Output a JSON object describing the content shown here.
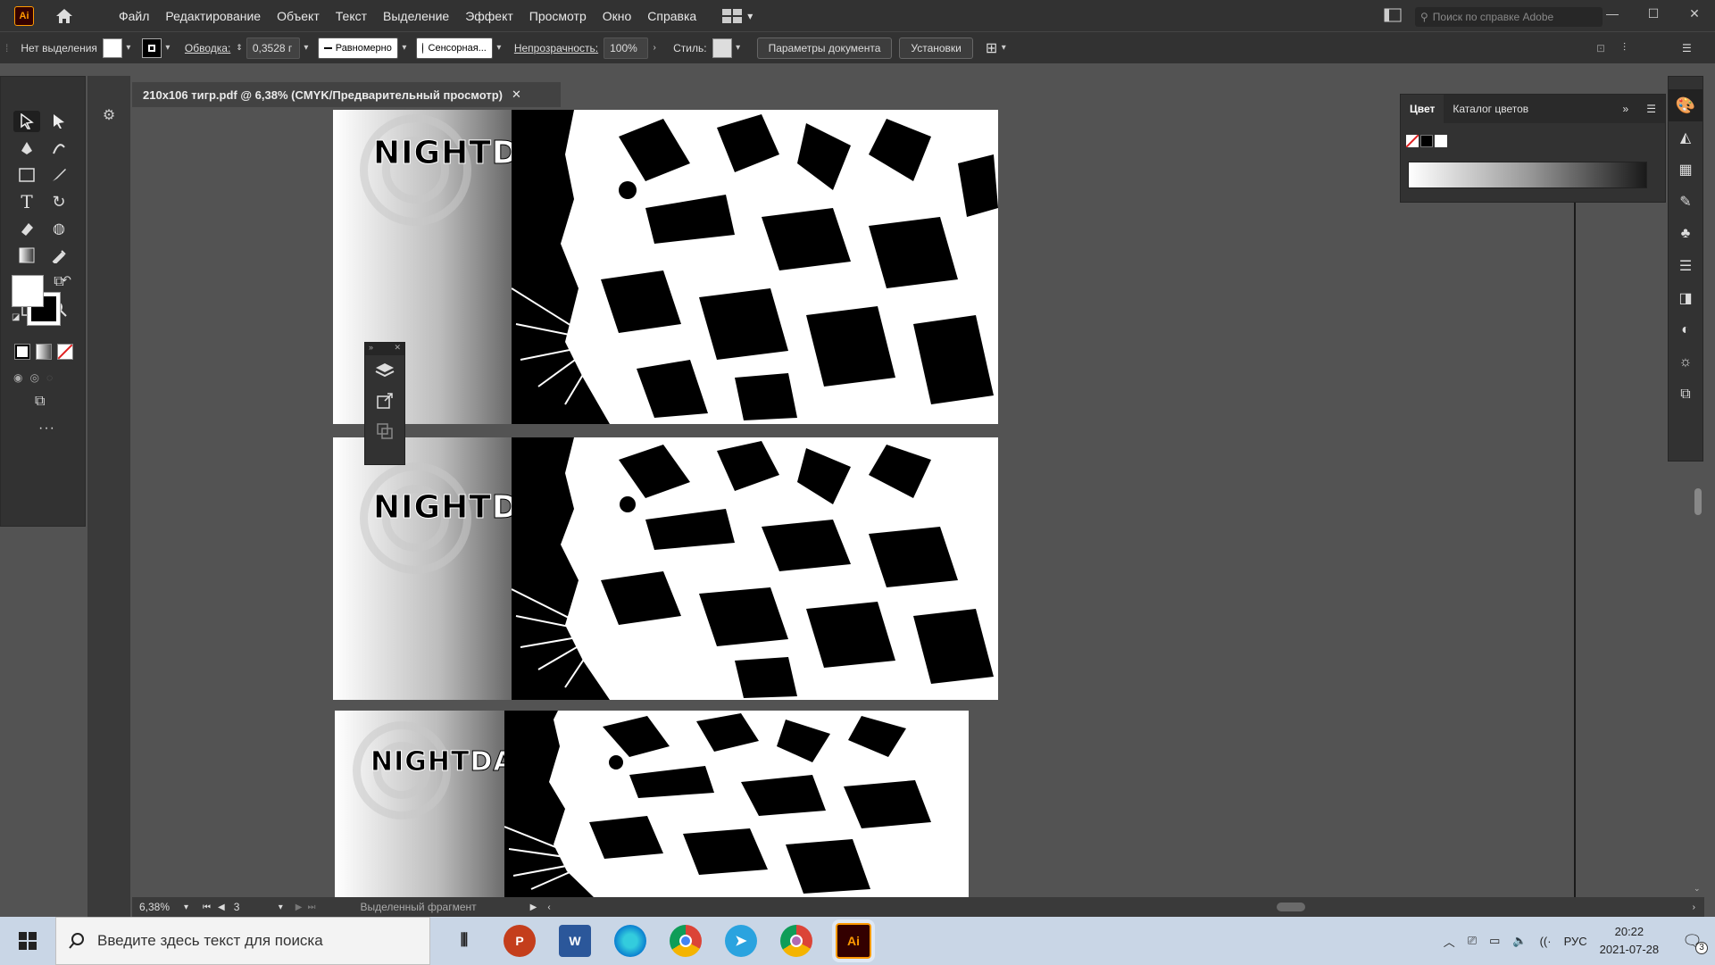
{
  "app": {
    "logo": "Ai",
    "home_icon": "home-icon"
  },
  "menu": [
    "Файл",
    "Редактирование",
    "Объект",
    "Текст",
    "Выделение",
    "Эффект",
    "Просмотр",
    "Окно",
    "Справка"
  ],
  "search": {
    "placeholder": "Поиск по справке Adobe"
  },
  "window_controls": [
    "—",
    "☐",
    "✕"
  ],
  "control_bar": {
    "selection_label": "Нет выделения",
    "stroke_label": "Обводка:",
    "stroke_value": "0,3528 г",
    "profile": "Равномерно",
    "brush": "Сенсорная...",
    "opacity_label": "Непрозрачность:",
    "opacity_value": "100%",
    "style_label": "Стиль:",
    "doc_setup": "Параметры документа",
    "prefs": "Установки"
  },
  "document_tab": {
    "title": "210х106 тигр.pdf @ 6,38% (CMYK/Предварительный просмотр)",
    "close": "✕"
  },
  "artboards": [
    {
      "night": "NIGHT",
      "day": "DAY"
    },
    {
      "night": "NIGHT",
      "day": "DAY"
    },
    {
      "night": "NIGHT",
      "day": "DAY"
    }
  ],
  "color_panel": {
    "tab_color": "Цвет",
    "tab_catalog": "Каталог цветов"
  },
  "status": {
    "zoom": "6,38%",
    "artboard_num": "3",
    "status_text": "Выделенный фрагмент"
  },
  "taskbar": {
    "search_placeholder": "Введите здесь текст для поиска",
    "apps": [
      "task-view",
      "powerpoint",
      "word",
      "edge",
      "chrome",
      "telegram",
      "chrome-profile",
      "illustrator"
    ],
    "lang": "РУС",
    "time": "20:22",
    "date": "2021-07-28",
    "notif": "3"
  },
  "colors": {
    "accent": "#ff9a00",
    "ui_dark": "#323232",
    "canvas": "#535353"
  }
}
